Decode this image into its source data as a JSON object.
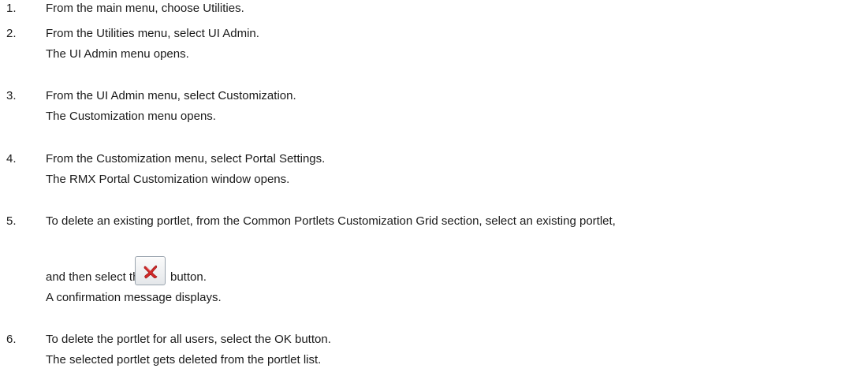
{
  "steps": [
    {
      "number": "1.",
      "lines": [
        "From the main menu, choose Utilities."
      ]
    },
    {
      "number": "2.",
      "lines": [
        "From the Utilities menu, select UI Admin.",
        "The UI Admin menu opens."
      ]
    },
    {
      "number": "3.",
      "lines": [
        "From the UI Admin menu, select Customization.",
        "The Customization menu opens."
      ]
    },
    {
      "number": "4.",
      "lines": [
        "From the Customization menu, select Portal Settings.",
        "The RMX Portal Customization window opens."
      ]
    },
    {
      "number": "5.",
      "lines": [
        "To delete an existing portlet, from the Common Portlets Customization Grid section, select an existing portlet,",
        "and then select the",
        "button.",
        "A confirmation message displays."
      ]
    },
    {
      "number": "6.",
      "lines": [
        "To delete the portlet for all users, select the OK button.",
        "The selected portlet gets deleted from the portlet list."
      ]
    }
  ],
  "icons": {
    "delete_button_icon": "red-x-delete-icon"
  },
  "colors": {
    "text": "#1a1a1a",
    "delete_icon": "#d42a2a"
  }
}
